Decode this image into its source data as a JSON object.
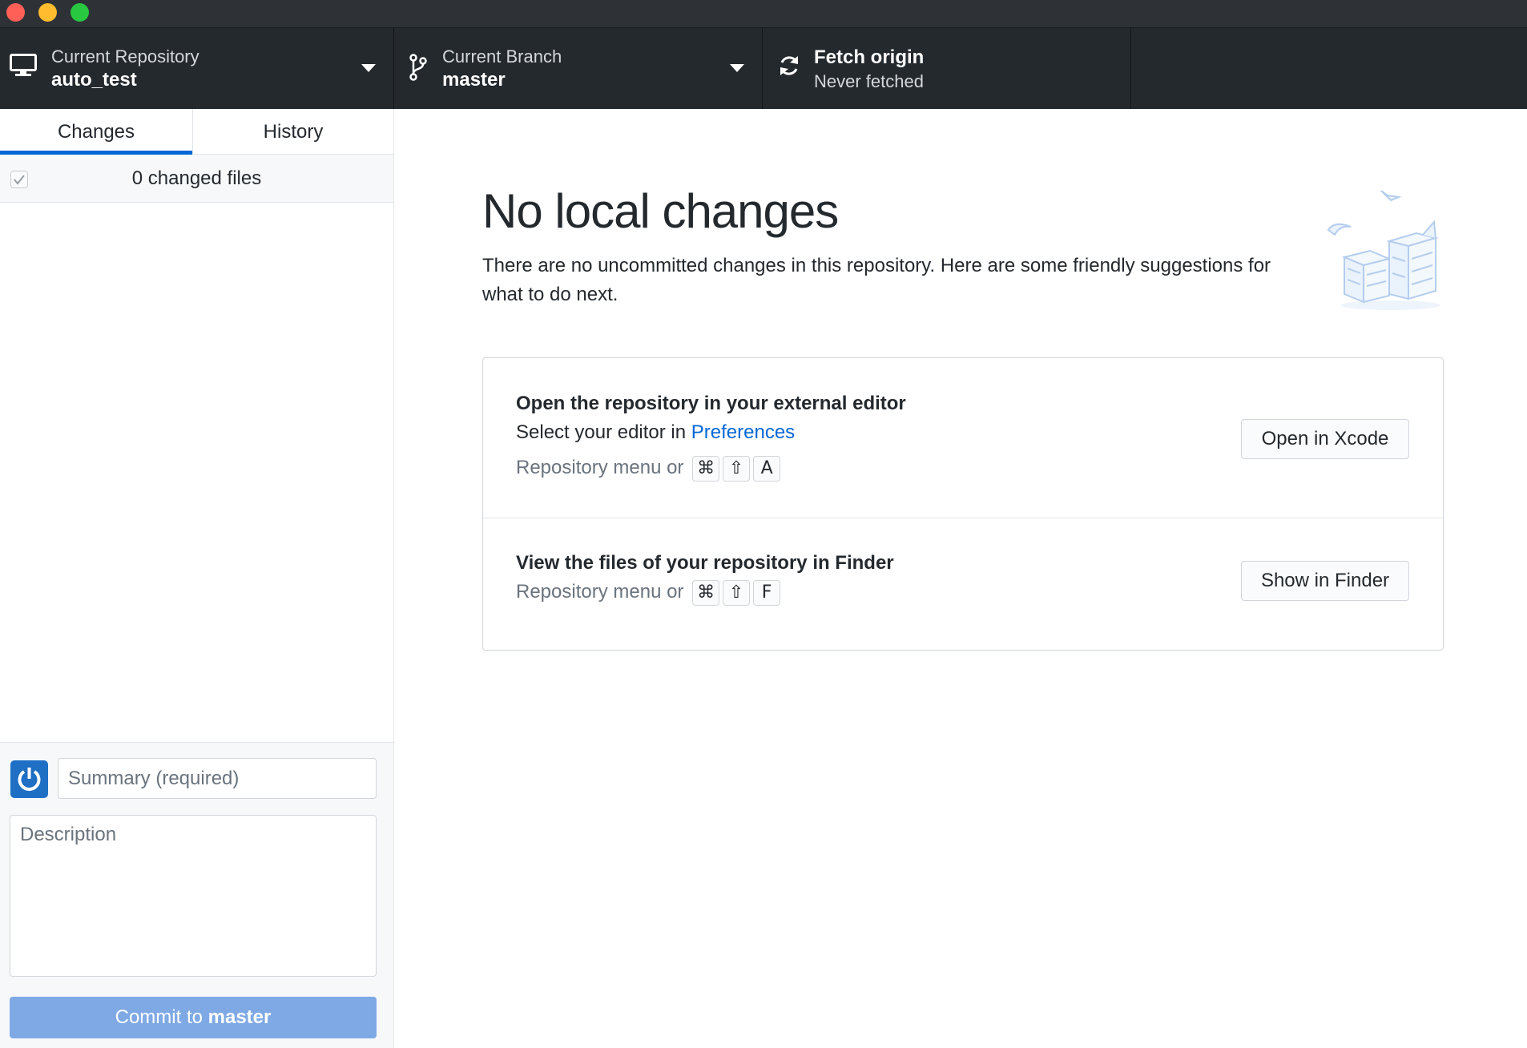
{
  "toolbar": {
    "repository": {
      "label": "Current Repository",
      "value": "auto_test"
    },
    "branch": {
      "label": "Current Branch",
      "value": "master"
    },
    "fetch": {
      "title": "Fetch origin",
      "subtitle": "Never fetched"
    }
  },
  "sidebar": {
    "tabs": [
      {
        "label": "Changes",
        "active": true
      },
      {
        "label": "History",
        "active": false
      }
    ],
    "changed_files": "0 changed files",
    "commit": {
      "summary_placeholder": "Summary (required)",
      "description_placeholder": "Description",
      "button_prefix": "Commit to ",
      "button_branch": "master"
    }
  },
  "main": {
    "title": "No local changes",
    "subtitle": "There are no uncommitted changes in this repository. Here are some friendly suggestions for what to do next.",
    "suggestions": [
      {
        "title": "Open the repository in your external editor",
        "desc_prefix": "Select your editor in ",
        "desc_link": "Preferences",
        "shortcut_prefix": "Repository menu or",
        "keys": [
          "⌘",
          "⇧",
          "A"
        ],
        "button": "Open in Xcode"
      },
      {
        "title": "View the files of your repository in Finder",
        "shortcut_prefix": "Repository menu or",
        "keys": [
          "⌘",
          "⇧",
          "F"
        ],
        "button": "Show in Finder"
      }
    ]
  },
  "colors": {
    "toolbar_bg": "#24292e",
    "accent": "#0366d6",
    "commit_button": "#7ea9e4"
  },
  "icons": {
    "repository": "desktop-computer-icon",
    "branch": "git-branch-icon",
    "fetch": "sync-icon",
    "avatar": "power-avatar-icon"
  }
}
